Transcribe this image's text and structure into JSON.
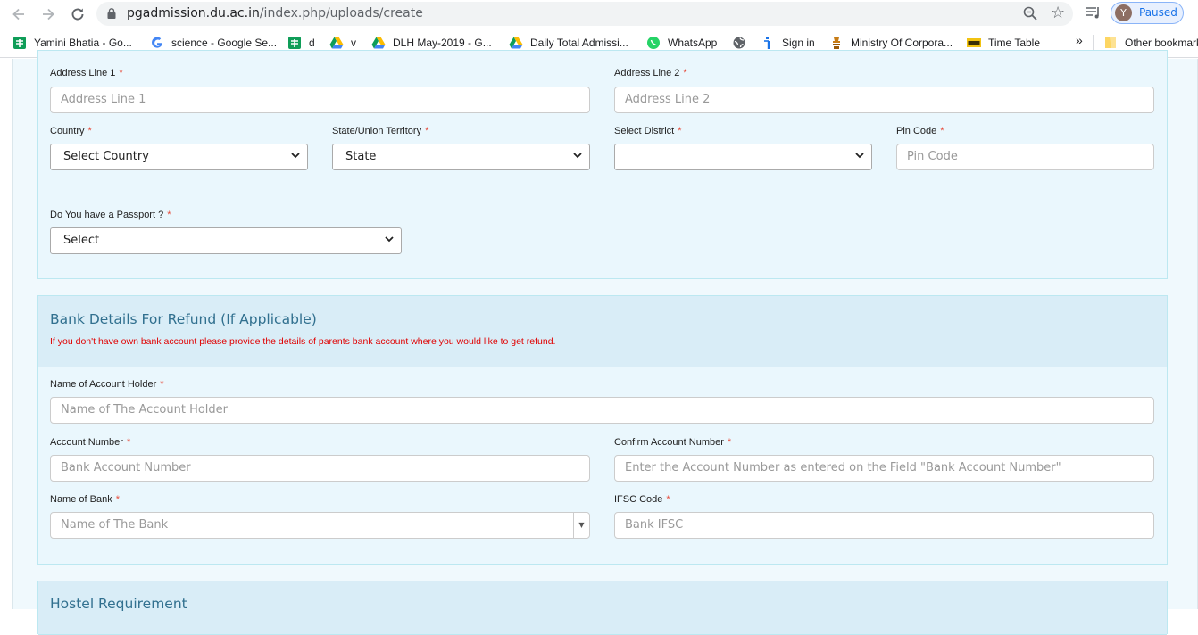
{
  "browser": {
    "url_host": "pgadmission.du.ac.in",
    "url_path": "/index.php/uploads/create",
    "profile_initial": "Y",
    "profile_status": "Paused"
  },
  "bookmarks": [
    {
      "label": "Yamini Bhatia - Go...",
      "icon": "sheets-icon"
    },
    {
      "label": "science - Google Se...",
      "icon": "google-icon"
    },
    {
      "label": "d",
      "icon": "sheets-icon"
    },
    {
      "label": "v",
      "icon": "drive-icon"
    },
    {
      "label": "DLH May-2019 - G...",
      "icon": "drive-icon"
    },
    {
      "label": "Daily Total Admissi...",
      "icon": "drive-icon"
    },
    {
      "label": "WhatsApp",
      "icon": "whatsapp-icon"
    },
    {
      "label": "",
      "icon": "globe-icon"
    },
    {
      "label": "Sign in",
      "icon": "signin-icon"
    },
    {
      "label": "Ministry Of Corpora...",
      "icon": "emblem-icon"
    },
    {
      "label": "Time Table",
      "icon": "timetable-icon"
    }
  ],
  "bookmarks_more": "»",
  "other_bookmarks": "Other bookmarks",
  "address": {
    "line1_label": "Address Line 1",
    "line1_placeholder": "Address Line 1",
    "line2_label": "Address Line 2",
    "line2_placeholder": "Address Line 2",
    "country_label": "Country",
    "country_value": "Select Country",
    "state_label": "State/Union Territory",
    "state_value": "State",
    "district_label": "Select District",
    "district_value": "",
    "pin_label": "Pin Code",
    "pin_placeholder": "Pin Code",
    "passport_label": "Do You have a Passport ?",
    "passport_value": "Select"
  },
  "bank": {
    "title": "Bank Details For Refund (If Applicable)",
    "note": "If you don't have own bank account please provide the details of parents bank account where you would like to get refund.",
    "holder_label": "Name of Account Holder",
    "holder_placeholder": "Name of The Account Holder",
    "account_label": "Account Number",
    "account_placeholder": "Bank Account Number",
    "confirm_label": "Confirm Account Number",
    "confirm_placeholder": "Enter the Account Number as entered on the Field \"Bank Account Number\"",
    "bank_name_label": "Name of Bank",
    "bank_name_placeholder": "Name of The Bank",
    "ifsc_label": "IFSC Code",
    "ifsc_placeholder": "Bank IFSC"
  },
  "hostel": {
    "title": "Hostel Requirement"
  },
  "required_mark": "*",
  "colors": {
    "panel_heading_bg": "#d9edf7",
    "panel_title": "#31708f",
    "required": "#e74c3c",
    "note": "#e00000"
  }
}
